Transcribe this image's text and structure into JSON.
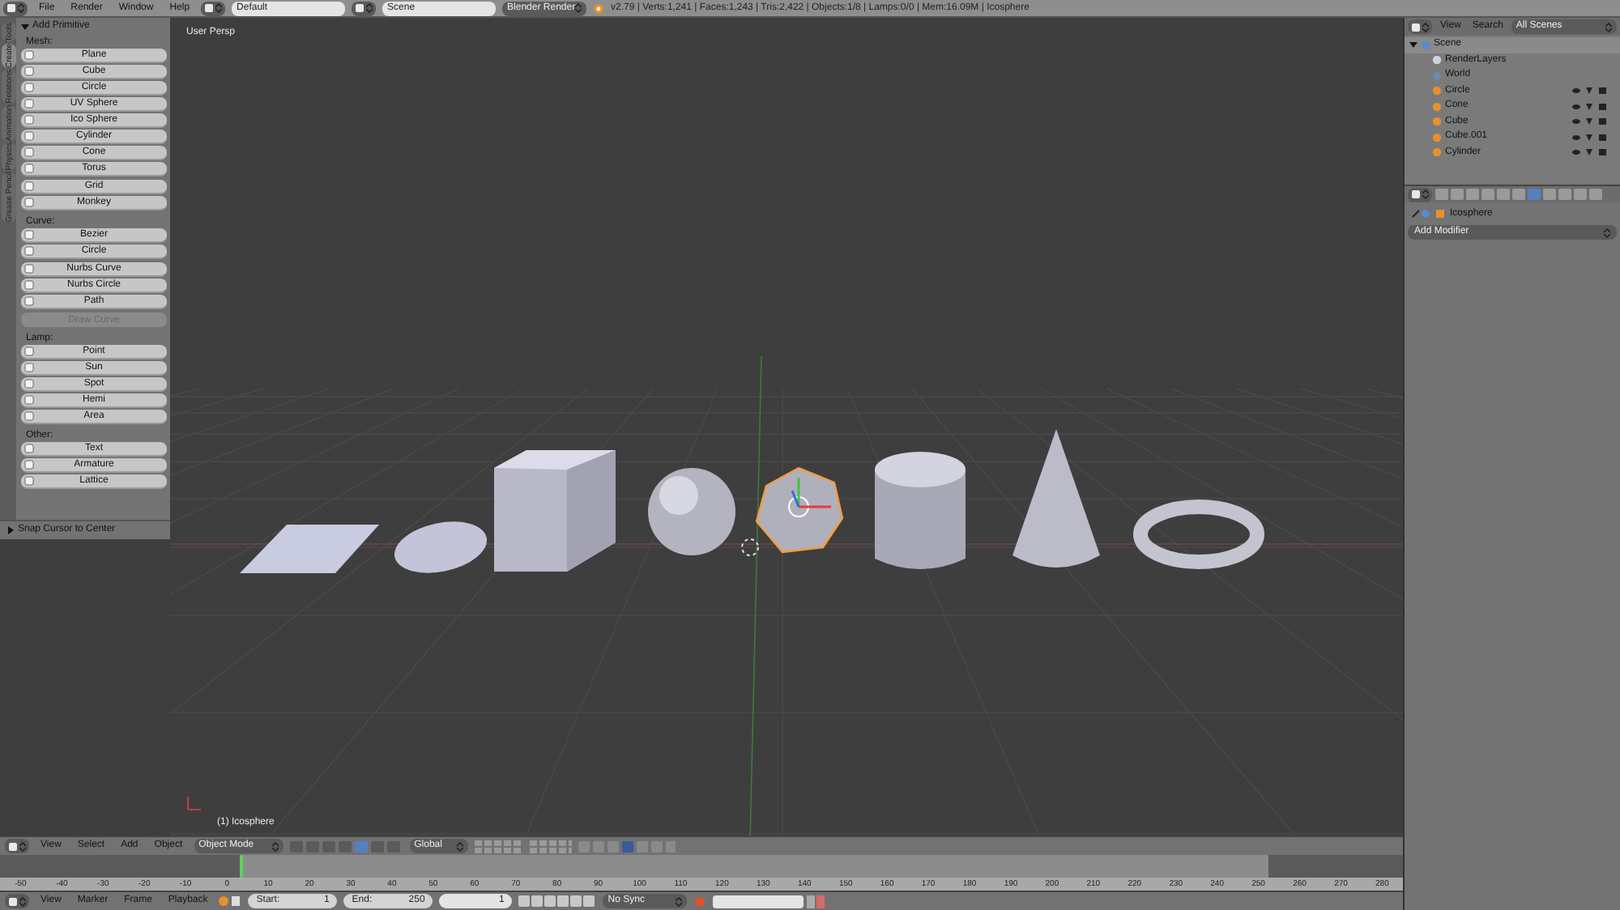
{
  "top_bar": {
    "menus": [
      "File",
      "Render",
      "Window",
      "Help"
    ],
    "layout": "Default",
    "scene": "Scene",
    "engine": "Blender Render",
    "stats": "v2.79 | Verts:1,241 | Faces:1,243 | Tris:2,422 | Objects:1/8 | Lamps:0/0 | Mem:16.09M | Icosphere"
  },
  "tool_tabs": [
    {
      "label": "Tools",
      "selected": false
    },
    {
      "label": "Create",
      "selected": true
    },
    {
      "label": "Relations",
      "selected": false
    },
    {
      "label": "Animation",
      "selected": false
    },
    {
      "label": "Physics",
      "selected": false
    },
    {
      "label": "Grease Pencil",
      "selected": false
    }
  ],
  "add_primitive": {
    "title": "Add Primitive",
    "expanded": true,
    "sections": [
      {
        "heading": "Mesh:",
        "groups": [
          [
            {
              "label": "Plane",
              "disabled": false
            },
            {
              "label": "Cube",
              "disabled": false
            },
            {
              "label": "Circle",
              "disabled": false
            },
            {
              "label": "UV Sphere",
              "disabled": false
            },
            {
              "label": "Ico Sphere",
              "disabled": false
            },
            {
              "label": "Cylinder",
              "disabled": false
            },
            {
              "label": "Cone",
              "disabled": false
            },
            {
              "label": "Torus",
              "disabled": false
            }
          ],
          [
            {
              "label": "Grid",
              "disabled": false
            },
            {
              "label": "Monkey",
              "disabled": false
            }
          ]
        ]
      },
      {
        "heading": "Curve:",
        "groups": [
          [
            {
              "label": "Bezier",
              "disabled": false
            },
            {
              "label": "Circle",
              "disabled": false
            }
          ],
          [
            {
              "label": "Nurbs Curve",
              "disabled": false
            },
            {
              "label": "Nurbs Circle",
              "disabled": false
            },
            {
              "label": "Path",
              "disabled": false
            }
          ],
          [
            {
              "label": "Draw Curve",
              "disabled": true
            }
          ]
        ]
      },
      {
        "heading": "Lamp:",
        "groups": [
          [
            {
              "label": "Point",
              "disabled": false
            },
            {
              "label": "Sun",
              "disabled": false
            },
            {
              "label": "Spot",
              "disabled": false
            },
            {
              "label": "Hemi",
              "disabled": false
            },
            {
              "label": "Area",
              "disabled": false
            }
          ]
        ]
      },
      {
        "heading": "Other:",
        "groups": [
          [
            {
              "label": "Text",
              "disabled": false
            },
            {
              "label": "Armature",
              "disabled": false
            },
            {
              "label": "Lattice",
              "disabled": false
            }
          ]
        ]
      }
    ]
  },
  "snap_panel": {
    "title": "Snap Cursor to Center",
    "expanded": false
  },
  "viewport": {
    "view_label": "User Persp",
    "object_label": "(1) Icosphere",
    "objects": [
      {
        "kind": "plane",
        "selected": false
      },
      {
        "kind": "disc",
        "selected": false
      },
      {
        "kind": "cube",
        "selected": false
      },
      {
        "kind": "sphere",
        "selected": false
      },
      {
        "kind": "icosphere",
        "selected": true
      },
      {
        "kind": "cylinder",
        "selected": false
      },
      {
        "kind": "cone",
        "selected": false
      },
      {
        "kind": "torus",
        "selected": false
      }
    ]
  },
  "outliner": {
    "menus": [
      "View",
      "Search"
    ],
    "filter": "All Scenes",
    "tree": [
      {
        "label": "Scene",
        "kind": "scene",
        "selected": true,
        "children": [
          {
            "label": "RenderLayers",
            "kind": "layers",
            "selected": false
          },
          {
            "label": "World",
            "kind": "world",
            "selected": false
          },
          {
            "label": "Circle",
            "kind": "object",
            "selected": false
          },
          {
            "label": "Cone",
            "kind": "object",
            "selected": false
          },
          {
            "label": "Cube",
            "kind": "object",
            "selected": false
          },
          {
            "label": "Cube.001",
            "kind": "object",
            "selected": false
          },
          {
            "label": "Cylinder",
            "kind": "object",
            "selected": false
          }
        ]
      }
    ]
  },
  "properties": {
    "object_name": "Icosphere",
    "add_modifier": "Add Modifier"
  },
  "view3d_header": {
    "menus": [
      "View",
      "Select",
      "Add",
      "Object"
    ],
    "mode": "Object Mode",
    "orientation": "Global"
  },
  "timeline": {
    "ticks": [
      "-50",
      "-40",
      "-30",
      "-20",
      "-10",
      "0",
      "10",
      "20",
      "30",
      "40",
      "50",
      "60",
      "70",
      "80",
      "90",
      "100",
      "110",
      "120",
      "130",
      "140",
      "150",
      "160",
      "170",
      "180",
      "190",
      "200",
      "210",
      "220",
      "230",
      "240",
      "250",
      "260",
      "270",
      "280"
    ],
    "menus": [
      "View",
      "Marker",
      "Frame",
      "Playback"
    ],
    "start_label": "Start:",
    "start": "1",
    "end_label": "End:",
    "end": "250",
    "current": "1",
    "sync": "No Sync"
  }
}
